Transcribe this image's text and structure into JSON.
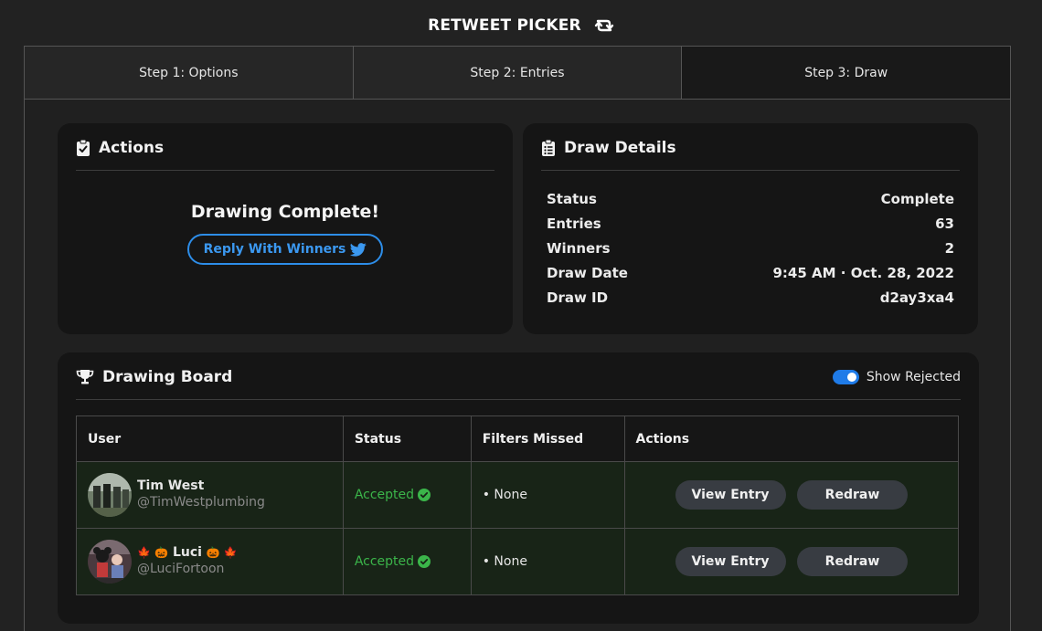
{
  "app": {
    "title": "RETWEET PICKER",
    "icon": "retweet-icon"
  },
  "steps": [
    {
      "label": "Step 1: Options",
      "active": false
    },
    {
      "label": "Step 2: Entries",
      "active": false
    },
    {
      "label": "Step 3: Draw",
      "active": true
    }
  ],
  "actions": {
    "title": "Actions",
    "icon": "clipboard-check-icon",
    "message": "Drawing Complete!",
    "reply_button": "Reply With Winners",
    "reply_icon": "twitter-bird-icon"
  },
  "details": {
    "title": "Draw Details",
    "icon": "clipboard-list-icon",
    "rows": [
      {
        "label": "Status",
        "value": "Complete"
      },
      {
        "label": "Entries",
        "value": "63"
      },
      {
        "label": "Winners",
        "value": "2"
      },
      {
        "label": "Draw Date",
        "value": "9:45 AM · Oct. 28, 2022"
      },
      {
        "label": "Draw ID",
        "value": "d2ay3xa4"
      }
    ]
  },
  "board": {
    "title": "Drawing Board",
    "icon": "trophy-icon",
    "toggle_label": "Show Rejected",
    "toggle_on": true,
    "columns": [
      "User",
      "Status",
      "Filters Missed",
      "Actions"
    ],
    "rows": [
      {
        "name": "Tim West",
        "handle": "@TimWestplumbing",
        "status": "Accepted",
        "filters_missed": "• None",
        "view_label": "View Entry",
        "redraw_label": "Redraw"
      },
      {
        "name_prefix": "🍁 🎃",
        "name": "Luci",
        "name_suffix": "🎃 🍁",
        "handle": "@LuciFortoon",
        "status": "Accepted",
        "filters_missed": "• None",
        "view_label": "View Entry",
        "redraw_label": "Redraw"
      }
    ]
  },
  "colors": {
    "accent": "#2d8de8",
    "accepted": "#3bb54a",
    "row_bg": "#182417",
    "card_bg": "#151515"
  }
}
